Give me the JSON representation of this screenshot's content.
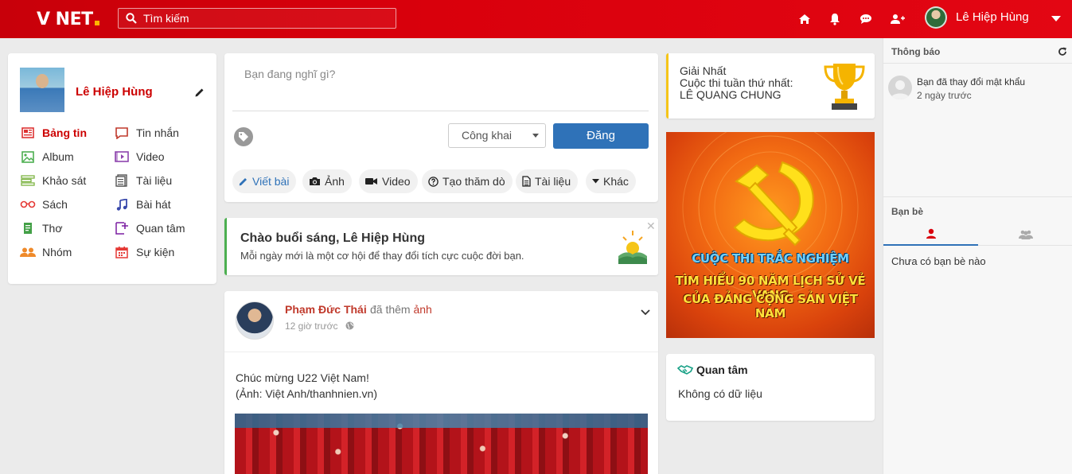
{
  "header": {
    "logo": "V NET",
    "search_placeholder": "Tìm kiếm",
    "user_name": "Lê Hiệp Hùng",
    "icons": [
      "home-icon",
      "bell-icon",
      "chat-icon",
      "add-friend-icon",
      "caret-down-icon"
    ]
  },
  "profile": {
    "name": "Lê Hiệp Hùng",
    "menu": [
      {
        "label": "Bảng tin",
        "icon": "news-icon",
        "active": true
      },
      {
        "label": "Tin nhắn",
        "icon": "message-icon",
        "active": false
      },
      {
        "label": "Album",
        "icon": "album-icon",
        "active": false
      },
      {
        "label": "Video",
        "icon": "video-icon",
        "active": false
      },
      {
        "label": "Khảo sát",
        "icon": "survey-icon",
        "active": false
      },
      {
        "label": "Tài liệu",
        "icon": "document-icon",
        "active": false
      },
      {
        "label": "Sách",
        "icon": "glasses-icon",
        "active": false
      },
      {
        "label": "Bài hát",
        "icon": "music-icon",
        "active": false
      },
      {
        "label": "Thơ",
        "icon": "poem-icon",
        "active": false
      },
      {
        "label": "Quan tâm",
        "icon": "interest-icon",
        "active": false
      },
      {
        "label": "Nhóm",
        "icon": "group-icon",
        "active": false
      },
      {
        "label": "Sự kiện",
        "icon": "calendar-icon",
        "active": false
      }
    ]
  },
  "composer": {
    "placeholder": "Bạn đang nghĩ gì?",
    "privacy": "Công khai",
    "post_label": "Đăng",
    "actions": [
      "Viết bài",
      "Ảnh",
      "Video",
      "Tạo thăm dò",
      "Tài liệu",
      "Khác"
    ]
  },
  "greeting": {
    "title": "Chào buổi sáng, Lê Hiệp Hùng",
    "subtitle": "Mỗi ngày mới là một cơ hội để thay đổi tích cực cuộc đời bạn."
  },
  "post": {
    "author": "Phạm Đức Thái",
    "action_prefix": "đã thêm",
    "action_object": "ảnh",
    "time": "12 giờ trước",
    "line1": "Chúc mừng U22 Việt Nam!",
    "line2": "(Ảnh: Việt Anh/thanhnien.vn)"
  },
  "award": {
    "line1": "Giải Nhất",
    "line2": "Cuộc thi tuần thứ nhất:",
    "line3": "LÊ QUANG CHUNG"
  },
  "banner": {
    "line1": "CUỘC THI TRẮC NGHIỆM",
    "line2": "TÌM HIỂU 90 NĂM LỊCH SỬ VẺ VANG",
    "line3": "CỦA ĐẢNG CỘNG SẢN VIỆT NAM"
  },
  "interest": {
    "title": "Quan tâm",
    "empty": "Không có dữ liệu"
  },
  "notifications": {
    "title": "Thông báo",
    "item_text": "Bạn đã thay đổi mật khẩu",
    "item_time": "2 ngày trước"
  },
  "friends": {
    "title": "Bạn bè",
    "empty": "Chưa có bạn bè nào"
  },
  "colors": {
    "brand_red": "#d9000c",
    "primary_blue": "#2f72b8",
    "link_red": "#c00"
  }
}
